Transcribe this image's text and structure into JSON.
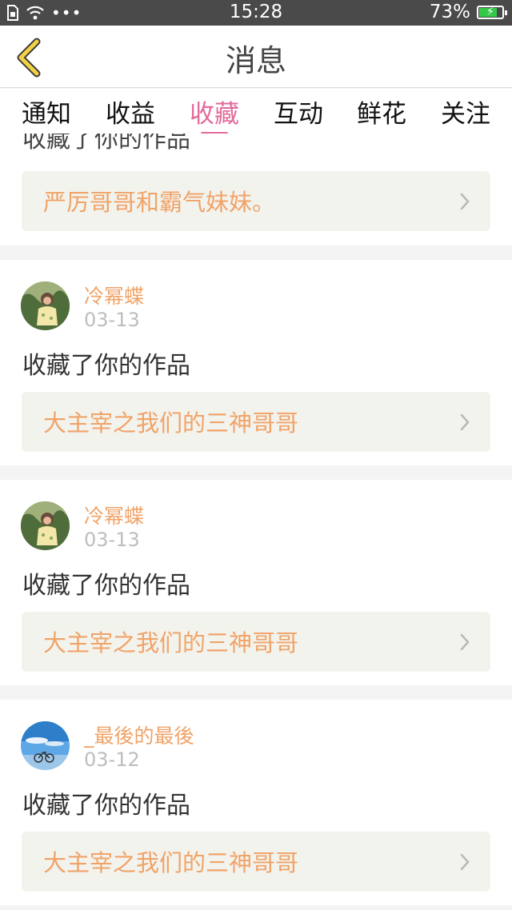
{
  "status_bar": {
    "time": "15:28",
    "battery": "73%",
    "battery_level": 0.73
  },
  "header": {
    "title": "消息",
    "back_icon": "chevron-left-icon"
  },
  "tabs": [
    {
      "label": "通知",
      "active": false
    },
    {
      "label": "收益",
      "active": false
    },
    {
      "label": "收藏",
      "active": true
    },
    {
      "label": "互动",
      "active": false
    },
    {
      "label": "鲜花",
      "active": false
    },
    {
      "label": "关注",
      "active": false
    }
  ],
  "feed": {
    "partial": {
      "action": "收藏了你的作品",
      "work_title": "严厉哥哥和霸气妹妹。"
    },
    "items": [
      {
        "username": "冷幂蝶",
        "date": "03-13",
        "action": "收藏了你的作品",
        "work_title": "大主宰之我们的三神哥哥"
      },
      {
        "username": "冷幂蝶",
        "date": "03-13",
        "action": "收藏了你的作品",
        "work_title": "大主宰之我们的三神哥哥"
      },
      {
        "username": "_最後的最後",
        "date": "03-12",
        "action": "收藏了你的作品",
        "work_title": "大主宰之我们的三神哥哥"
      }
    ]
  },
  "colors": {
    "accent": "#e26a9b",
    "username": "#f0a368",
    "status_bar": "#4a4a4a"
  }
}
